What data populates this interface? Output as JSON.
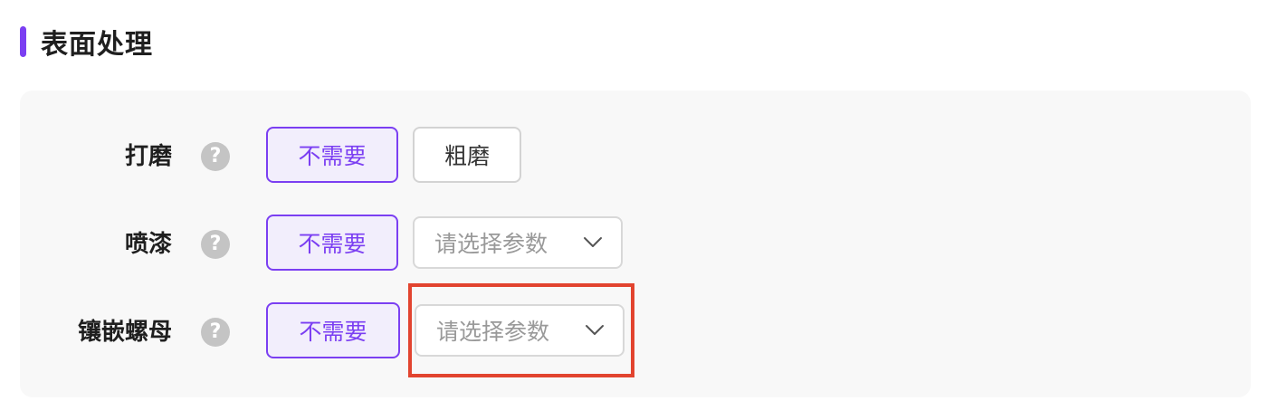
{
  "section": {
    "title": "表面处理",
    "accent_color": "#7b3ff2"
  },
  "rows": [
    {
      "label": "打磨",
      "help_icon": "question-circle-icon",
      "options": [
        {
          "label": "不需要",
          "selected": true
        },
        {
          "label": "粗磨",
          "selected": false
        }
      ]
    },
    {
      "label": "喷漆",
      "help_icon": "question-circle-icon",
      "options": [
        {
          "label": "不需要",
          "selected": true
        }
      ],
      "select": {
        "placeholder": "请选择参数",
        "icon": "chevron-down-icon"
      }
    },
    {
      "label": "镶嵌螺母",
      "help_icon": "question-circle-icon",
      "options": [
        {
          "label": "不需要",
          "selected": true
        }
      ],
      "select": {
        "placeholder": "请选择参数",
        "icon": "chevron-down-icon"
      }
    }
  ],
  "help_glyph": "?",
  "colors": {
    "selected_border": "#7b3ff2",
    "selected_bg": "#f2eefc",
    "highlight": "#e2442f",
    "panel_bg": "#f8f8f8"
  }
}
